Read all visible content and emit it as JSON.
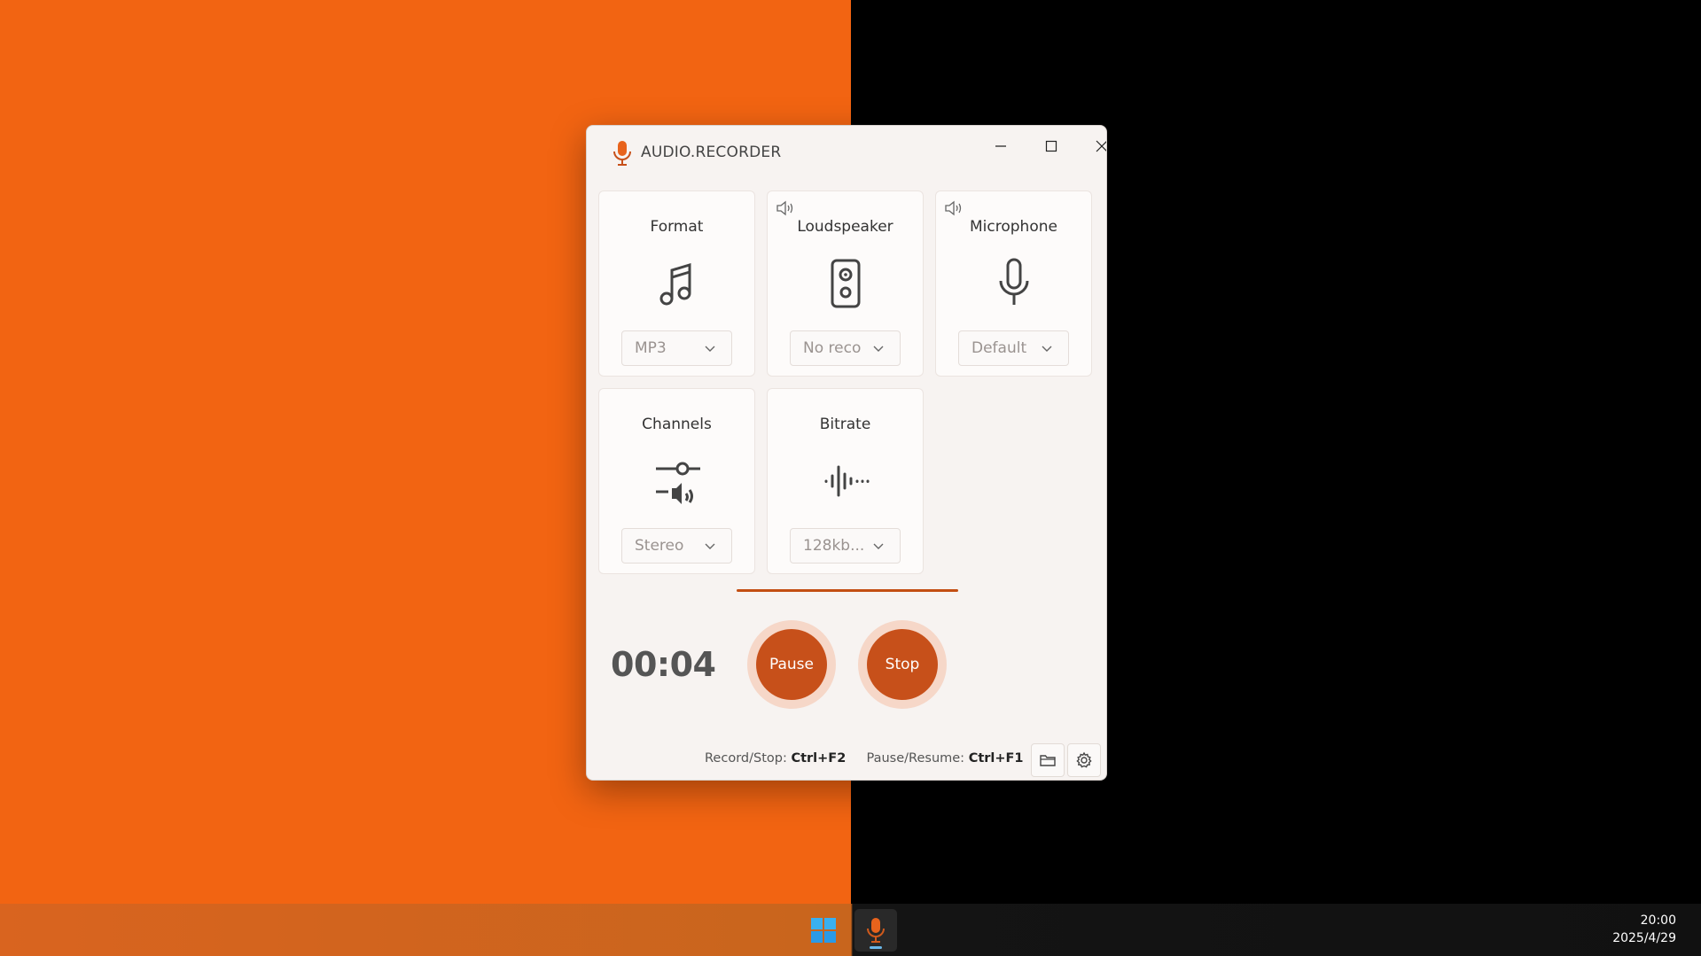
{
  "window": {
    "title": "AUDIO.RECORDER"
  },
  "cards": {
    "format": {
      "title": "Format",
      "value": "MP3"
    },
    "loudspeaker": {
      "title": "Loudspeaker",
      "value": "No reco"
    },
    "microphone": {
      "title": "Microphone",
      "value": "Default"
    },
    "channels": {
      "title": "Channels",
      "value": "Stereo"
    },
    "bitrate": {
      "title": "Bitrate",
      "value": "128kb..."
    }
  },
  "recording": {
    "timer": "00:04",
    "pause_label": "Pause",
    "stop_label": "Stop"
  },
  "shortcuts": {
    "record_label": "Record/Stop:",
    "record_key": "Ctrl+F2",
    "pause_label": "Pause/Resume:",
    "pause_key": "Ctrl+F1"
  },
  "taskbar": {
    "time": "20:00",
    "date": "2025/4/29"
  },
  "colors": {
    "accent": "#c7501a",
    "desktop_left": "#f26412",
    "desktop_right": "#000000"
  }
}
